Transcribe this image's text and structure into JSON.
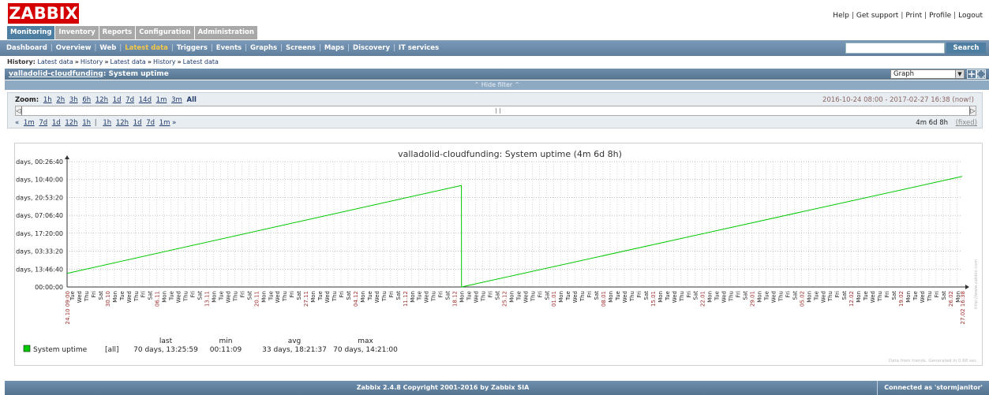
{
  "header": {
    "logo": "ZABBIX",
    "links": [
      "Help",
      "Get support",
      "Print",
      "Profile",
      "Logout"
    ]
  },
  "main_menu": [
    "Monitoring",
    "Inventory",
    "Reports",
    "Configuration",
    "Administration"
  ],
  "sub_menu": [
    "Dashboard",
    "Overview",
    "Web",
    "Latest data",
    "Triggers",
    "Events",
    "Graphs",
    "Screens",
    "Maps",
    "Discovery",
    "IT services"
  ],
  "search": {
    "button": "Search",
    "value": ""
  },
  "breadcrumb": {
    "label": "History:",
    "items": [
      "Latest data",
      "History",
      "Latest data",
      "History",
      "Latest data"
    ]
  },
  "title_bar": {
    "host": "valladolid-cloudfunding",
    "item": ": System uptime",
    "view": "Graph"
  },
  "filter_toggle": "⌃ Hide filter ⌃",
  "zoom": {
    "label": "Zoom:",
    "options": [
      "1h",
      "2h",
      "3h",
      "6h",
      "12h",
      "1d",
      "7d",
      "14d",
      "1m",
      "3m",
      "All"
    ],
    "date_range": "2016-10-24 08:00  -  2017-02-27 16:38 (now!)",
    "back_links": [
      "«",
      "1m",
      "7d",
      "1d",
      "12h",
      "1h"
    ],
    "fwd_links": [
      "1h",
      "12h",
      "1d",
      "7d",
      "1m",
      "»"
    ],
    "period_length": "4m 6d 8h",
    "fixed": "(fixed)"
  },
  "chart_data": {
    "type": "line",
    "title": "valladolid-cloudfunding: System uptime (4m 6d 8h)",
    "y_tick_labels": [
      "days, 00:26:40",
      "days, 10:40:00",
      "days, 20:53:20",
      "days, 07:06:40",
      "days, 17:20:00",
      "days, 03:33:20",
      "days, 13:46:40",
      "00:00:00"
    ],
    "y_range_days": [
      0,
      80.02
    ],
    "x_range": [
      "2016-10-24 08:00",
      "2017-02-27 16:38"
    ],
    "x_date_labels": [
      "24.10 09:00",
      "30.10",
      "06.11",
      "13.11",
      "20.11",
      "27.11",
      "04.12",
      "11.12",
      "18.12",
      "25.12",
      "01.01",
      "08.01",
      "15.01",
      "22.01",
      "29.01",
      "05.02",
      "12.02",
      "19.02",
      "26.02",
      "27.02 16:38"
    ],
    "weekday_cycle": [
      "Mon",
      "Tue",
      "Wed",
      "Thu",
      "Fri",
      "Sat",
      "Sun"
    ],
    "series": [
      {
        "name": "System uptime",
        "color": "#00c800",
        "points": [
          {
            "x": "2016-10-24 08:00",
            "y_days": 8.7
          },
          {
            "x": "2016-12-19 00:00",
            "y_days": 64.8
          },
          {
            "x": "2016-12-19 00:15",
            "y_days": 0.0
          },
          {
            "x": "2017-02-27 16:38",
            "y_days": 70.56
          }
        ]
      }
    ],
    "legend": {
      "headers": [
        "last",
        "min",
        "avg",
        "max"
      ],
      "name": "System uptime",
      "func": "[all]",
      "last": "70 days, 13:25:59",
      "min": "00:11:09",
      "avg": "33 days, 18:21:37",
      "max": "70 days, 14:21:00"
    },
    "side_text": "http://www.zabbix.com",
    "footer_note": "Data from trends. Generated in 0.68 sec."
  },
  "footer": {
    "copyright": "Zabbix 2.4.8 Copyright 2001-2016 by Zabbix SIA",
    "connected": "Connected as 'stormjanitor'"
  },
  "colors": {
    "logo": "#d40000",
    "menu_active": "#4f7ea3",
    "series": "#00c800",
    "date_label": "#a03030"
  }
}
